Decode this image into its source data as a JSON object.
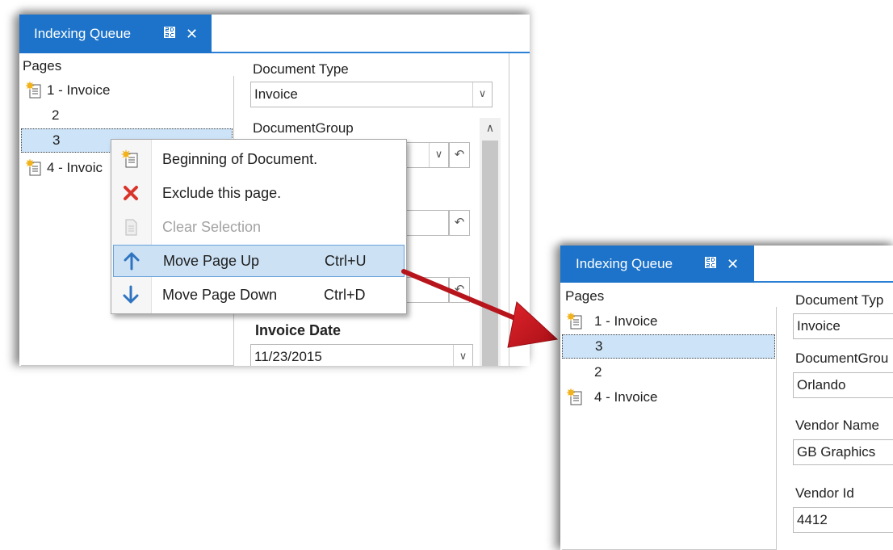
{
  "before": {
    "tab": {
      "title": "Indexing Queue",
      "pin": "⴬",
      "close": "✕"
    },
    "pages_label": "Pages",
    "pages": [
      {
        "label": "1 - Invoice",
        "has_icon": true
      },
      {
        "label": "2",
        "has_icon": false
      },
      {
        "label": "3",
        "has_icon": false,
        "selected": true
      },
      {
        "label": "4 - Invoic",
        "has_icon": true
      }
    ],
    "fields": {
      "document_type_label": "Document Type",
      "document_type_value": "Invoice",
      "document_group_label": "DocumentGroup",
      "invoice_date_label": "Invoice Date",
      "invoice_date_value": "11/23/2015"
    },
    "context_menu": [
      {
        "label": "Beginning of Document.",
        "shortcut": "",
        "icon": "document-star-icon",
        "state": "normal"
      },
      {
        "label": "Exclude this page.",
        "shortcut": "",
        "icon": "red-x-icon",
        "state": "normal"
      },
      {
        "label": "Clear Selection",
        "shortcut": "",
        "icon": "document-gray-icon",
        "state": "disabled"
      },
      {
        "label": "Move Page Up",
        "shortcut": "Ctrl+U",
        "icon": "arrow-up-icon",
        "state": "highlighted"
      },
      {
        "label": "Move Page Down",
        "shortcut": "Ctrl+D",
        "icon": "arrow-down-icon",
        "state": "normal"
      }
    ]
  },
  "after": {
    "tab": {
      "title": "Indexing Queue",
      "pin": "⴬",
      "close": "✕"
    },
    "pages_label": "Pages",
    "pages": [
      {
        "label": "1 - Invoice",
        "has_icon": true
      },
      {
        "label": "3",
        "has_icon": false,
        "selected": true
      },
      {
        "label": "2",
        "has_icon": false
      },
      {
        "label": "4 - Invoice",
        "has_icon": true
      }
    ],
    "fields": {
      "document_type_label": "Document Typ",
      "document_type_value": "Invoice",
      "document_group_label": "DocumentGrou",
      "document_group_value": "Orlando",
      "vendor_name_label": "Vendor Name",
      "vendor_name_value": "GB Graphics",
      "vendor_id_label": "Vendor Id",
      "vendor_id_value": "4412"
    }
  },
  "colors": {
    "tab_active": "#1c73c9",
    "selection": "#cde3f7",
    "menu_highlight": "#cce1f4",
    "arrow": "#c8161d",
    "up_down_arrows": "#2f74c0",
    "exclude_x": "#d9342b"
  }
}
